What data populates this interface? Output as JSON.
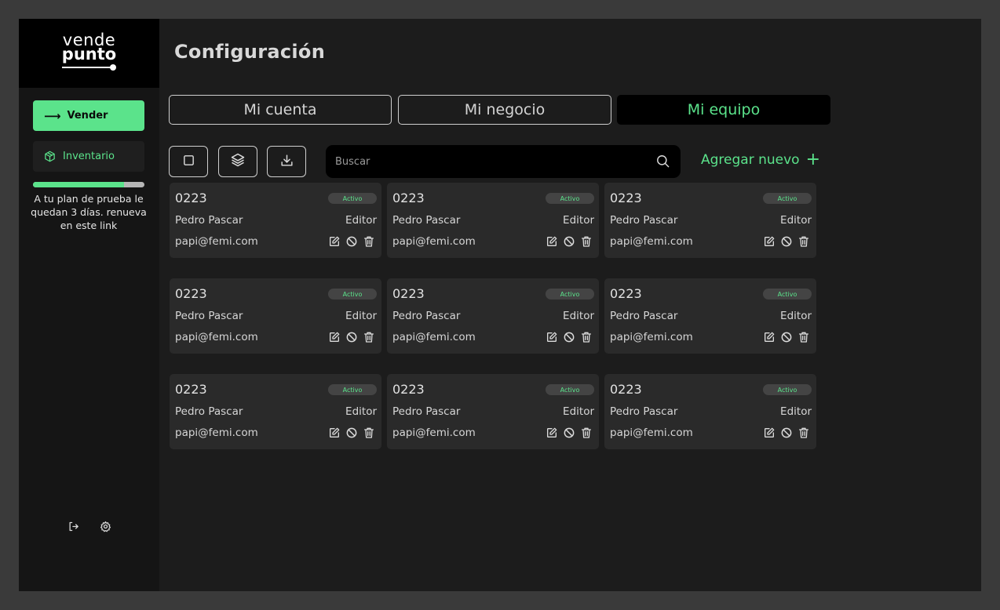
{
  "brand": {
    "line1": "vende",
    "line2": "punto"
  },
  "sidebar": {
    "vender_label": "Vender",
    "inventario_label": "Inventario",
    "trial_progress": 0.82,
    "trial_text": "A tu plan de prueba le quedan 3 días. renueva en este link"
  },
  "page": {
    "title": "Configuración"
  },
  "tabs": [
    {
      "label": "Mi cuenta",
      "active": false
    },
    {
      "label": "Mi negocio",
      "active": false
    },
    {
      "label": "Mi equipo",
      "active": true
    }
  ],
  "search": {
    "placeholder": "Buscar"
  },
  "add_new_label": "Agregar nuevo",
  "members": [
    {
      "code": "0223",
      "status": "Activo",
      "name": "Pedro Pascar",
      "role": "Editor",
      "email": "papi@femi.com"
    },
    {
      "code": "0223",
      "status": "Activo",
      "name": "Pedro Pascar",
      "role": "Editor",
      "email": "papi@femi.com"
    },
    {
      "code": "0223",
      "status": "Activo",
      "name": "Pedro Pascar",
      "role": "Editor",
      "email": "papi@femi.com"
    },
    {
      "code": "0223",
      "status": "Activo",
      "name": "Pedro Pascar",
      "role": "Editor",
      "email": "papi@femi.com"
    },
    {
      "code": "0223",
      "status": "Activo",
      "name": "Pedro Pascar",
      "role": "Editor",
      "email": "papi@femi.com"
    },
    {
      "code": "0223",
      "status": "Activo",
      "name": "Pedro Pascar",
      "role": "Editor",
      "email": "papi@femi.com"
    },
    {
      "code": "0223",
      "status": "Activo",
      "name": "Pedro Pascar",
      "role": "Editor",
      "email": "papi@femi.com"
    },
    {
      "code": "0223",
      "status": "Activo",
      "name": "Pedro Pascar",
      "role": "Editor",
      "email": "papi@femi.com"
    },
    {
      "code": "0223",
      "status": "Activo",
      "name": "Pedro Pascar",
      "role": "Editor",
      "email": "papi@femi.com"
    }
  ],
  "colors": {
    "accent": "#5be38b",
    "card": "#2a2a2a",
    "background": "#1c1c1c"
  },
  "icons": {
    "vender": "arrow-right-icon",
    "inventario": "box-icon",
    "select": "checkbox-icon",
    "layers": "layers-icon",
    "download": "download-icon",
    "search": "search-icon",
    "add": "plus-icon",
    "edit": "edit-icon",
    "block": "block-icon",
    "delete": "trash-icon",
    "logout": "logout-icon",
    "settings": "gear-icon"
  }
}
